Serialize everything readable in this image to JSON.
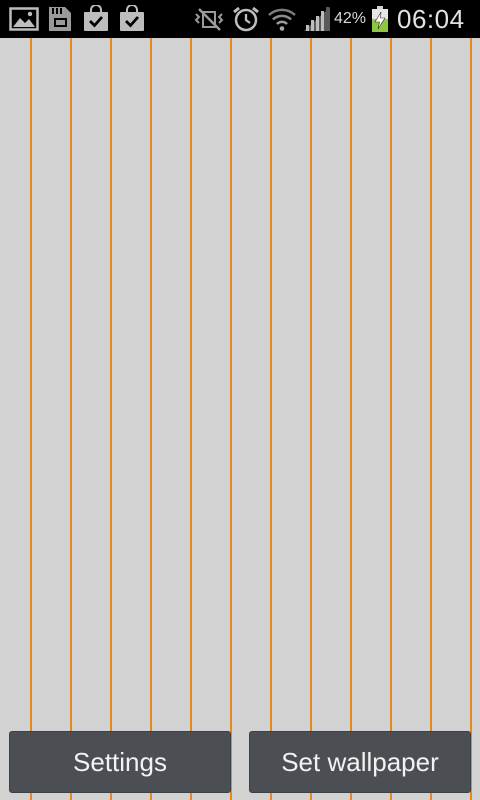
{
  "status_bar": {
    "icons": [
      "image-notification-icon",
      "sd-card-icon",
      "shopping-bag-check-icon",
      "shopping-bag-check-icon",
      "vibrate-mute-icon",
      "alarm-clock-icon",
      "wifi-icon",
      "signal-strength-icon",
      "battery-charging-icon"
    ],
    "battery_percent": "42%",
    "time": "06:04"
  },
  "wallpaper": {
    "background_color": "#d2d2d2",
    "stripe_color": "#e8891c",
    "stripe_count": 12
  },
  "buttons": {
    "settings_label": "Settings",
    "set_wallpaper_label": "Set wallpaper"
  }
}
